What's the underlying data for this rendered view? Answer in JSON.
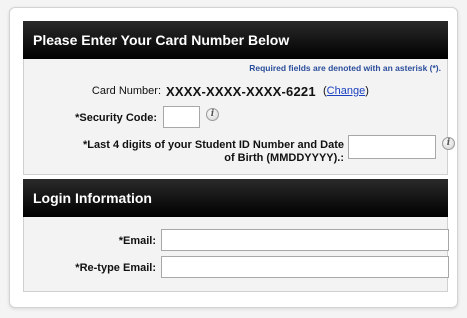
{
  "card_section": {
    "title": "Please Enter Your Card Number Below",
    "required_note": "Required fields are denoted with an asterisk (*).",
    "card_number_label": "Card Number:",
    "card_number_value": "XXXX-XXXX-XXXX-6221",
    "change_open": "(",
    "change_link": "Change",
    "change_close": ")",
    "security_code_label": "*Security Code:",
    "student_id_label_line1": "*Last 4 digits of your Student ID Number and Date",
    "student_id_label_line2": "of Birth (MMDDYYYY).:",
    "info_icon_glyph": "i"
  },
  "login_section": {
    "title": "Login Information",
    "email_label": "*Email:",
    "retype_email_label": "*Re-type Email:"
  }
}
